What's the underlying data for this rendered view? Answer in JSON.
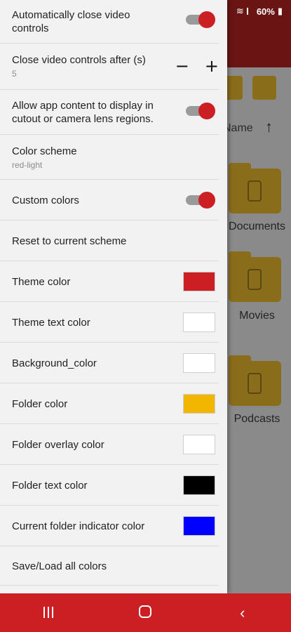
{
  "status": {
    "battery": "60%"
  },
  "background": {
    "sort_label": "Name",
    "sort_arrow": "↑",
    "folders": [
      "Documents",
      "Movies",
      "Podcasts"
    ]
  },
  "settings": {
    "auto_close": {
      "title": "Automatically close video controls",
      "enabled": true
    },
    "close_after": {
      "title": "Close video controls after (s)",
      "value": "5",
      "minus": "−",
      "plus": "+"
    },
    "cutout": {
      "title": "Allow app content to display in cutout or camera lens regions.",
      "enabled": true
    },
    "color_scheme": {
      "title": "Color scheme",
      "value": "red-light"
    },
    "custom_colors": {
      "title": "Custom colors",
      "enabled": true
    },
    "reset": {
      "title": "Reset to current scheme"
    },
    "theme_color": {
      "title": "Theme color",
      "color": "#cc1f24"
    },
    "theme_text_color": {
      "title": "Theme text color",
      "color": "#ffffff"
    },
    "background_color": {
      "title": "Background_color",
      "color": "#ffffff"
    },
    "folder_color": {
      "title": "Folder color",
      "color": "#f2b600"
    },
    "folder_overlay_color": {
      "title": "Folder overlay color",
      "color": "#ffffff"
    },
    "folder_text_color": {
      "title": "Folder text color",
      "color": "#000000"
    },
    "current_folder_indicator_color": {
      "title": "Current folder indicator color",
      "color": "#0000ff"
    },
    "save_load": {
      "title": "Save/Load all colors"
    }
  },
  "navbar": {
    "back": "‹"
  }
}
